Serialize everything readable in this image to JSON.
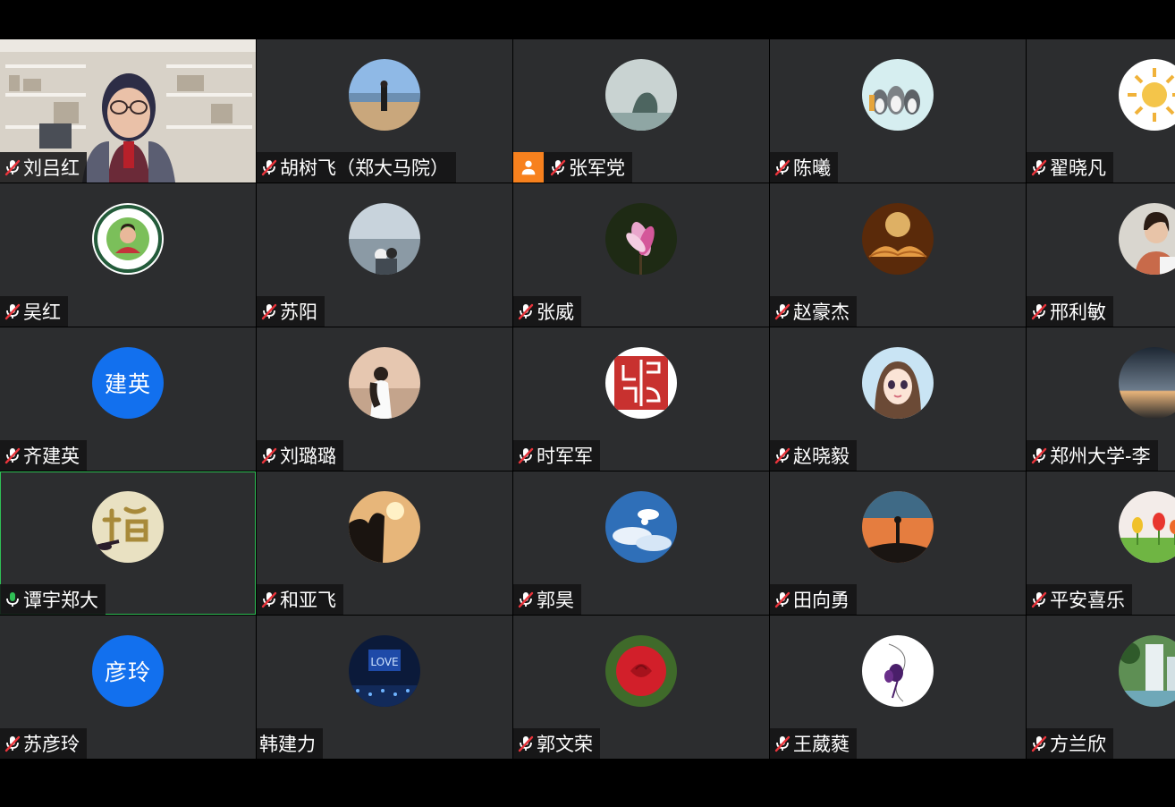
{
  "meeting": {
    "colors": {
      "tile_bg": "#2c2d2f",
      "active_border": "#2fbf55",
      "text_avatar_bg": "#1270ee",
      "host_badge": "#f7811e",
      "mic_on": "#2fbf55"
    },
    "participants": [
      {
        "name": "刘吕红",
        "mic": "muted",
        "avatar": "video"
      },
      {
        "name": "胡树飞（郑大马院）",
        "mic": "muted",
        "avatar": "beach-person-photo"
      },
      {
        "name": "张军党",
        "mic": "muted",
        "avatar": "misty-island-photo",
        "badge": "person-icon"
      },
      {
        "name": "陈曦",
        "mic": "muted",
        "avatar": "penguins-cartoon"
      },
      {
        "name": "翟晓凡",
        "mic": "muted",
        "avatar": "sun-drawing"
      },
      {
        "name": "吴红",
        "mic": "muted",
        "avatar": "university-seal-photo"
      },
      {
        "name": "苏阳",
        "mic": "muted",
        "avatar": "seaside-children-photo"
      },
      {
        "name": "张威",
        "mic": "muted",
        "avatar": "magnolia-photo"
      },
      {
        "name": "赵豪杰",
        "mic": "muted",
        "avatar": "open-book-photo"
      },
      {
        "name": "邢利敏",
        "mic": "muted",
        "avatar": "woman-portrait-photo"
      },
      {
        "name": "齐建英",
        "mic": "muted",
        "avatar": "text",
        "avatar_text": "建英"
      },
      {
        "name": "刘璐璐",
        "mic": "muted",
        "avatar": "girl-sunset-photo"
      },
      {
        "name": "时军军",
        "mic": "muted",
        "avatar": "seal-stamp-image"
      },
      {
        "name": "赵晓毅",
        "mic": "muted",
        "avatar": "anime-girl-drawing"
      },
      {
        "name": "郑州大学-李",
        "mic": "muted",
        "avatar": "dusk-horizon-photo"
      },
      {
        "name": "谭宇郑大",
        "mic": "on",
        "avatar": "calligraphy-image",
        "active": true
      },
      {
        "name": "和亚飞",
        "mic": "muted",
        "avatar": "silhouette-sun-photo"
      },
      {
        "name": "郭昊",
        "mic": "muted",
        "avatar": "blue-sky-clouds-photo"
      },
      {
        "name": "田向勇",
        "mic": "muted",
        "avatar": "sunset-hiker-photo"
      },
      {
        "name": "平安喜乐",
        "mic": "muted",
        "avatar": "tulips-photo"
      },
      {
        "name": "苏彦玲",
        "mic": "muted",
        "avatar": "text",
        "avatar_text": "彦玲"
      },
      {
        "name": "韩建力",
        "mic": "none",
        "avatar": "love-stage-photo"
      },
      {
        "name": "郭文荣",
        "mic": "muted",
        "avatar": "red-rose-photo"
      },
      {
        "name": "王葳蕤",
        "mic": "muted",
        "avatar": "purple-flower-sketch"
      },
      {
        "name": "方兰欣",
        "mic": "muted",
        "avatar": "waterfall-photo"
      }
    ]
  }
}
